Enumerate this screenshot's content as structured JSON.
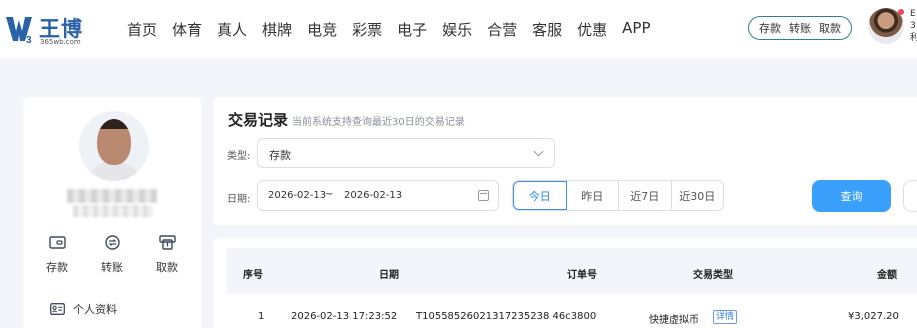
{
  "header": {
    "logo_text": "王博",
    "logo_sub": "365wb.com",
    "nav": [
      "首页",
      "体育",
      "真人",
      "棋牌",
      "电竞",
      "彩票",
      "电子",
      "娱乐",
      "合营",
      "客服",
      "优惠",
      "APP"
    ],
    "quick_actions": [
      "存款",
      "转账",
      "取款"
    ],
    "user_info_partial": [
      "E",
      "3",
      "利"
    ]
  },
  "sidebar": {
    "actions": [
      "存款",
      "转账",
      "取款"
    ],
    "profile_label": "个人资料"
  },
  "filter": {
    "title": "交易记录",
    "subtitle": "当前系统支持查询最近30日的交易记录",
    "type_label": "类型:",
    "type_value": "存款",
    "date_label": "日期:",
    "date_start": "2026-02-13",
    "date_separator": "~",
    "date_end": "2026-02-13",
    "ranges": [
      "今日",
      "昨日",
      "近7日",
      "近30日"
    ],
    "active_range": "今日",
    "query_button": "查询"
  },
  "table": {
    "columns": [
      "序号",
      "日期",
      "订单号",
      "交易类型",
      "金额"
    ],
    "rows": [
      {
        "index": "1",
        "date": "2026-02-13 17:23:52",
        "order_no": "T10558526021317235238 46c3800",
        "type": "快捷虚拟币",
        "detail": "详情",
        "amount": "¥3,027.20"
      }
    ]
  },
  "colors": {
    "brand_blue": "#2a62a8",
    "accent_blue": "#3ba0fb",
    "teal_border": "#2f7f8f",
    "background": "#f3f5fa",
    "notification_red": "#f0445b"
  }
}
